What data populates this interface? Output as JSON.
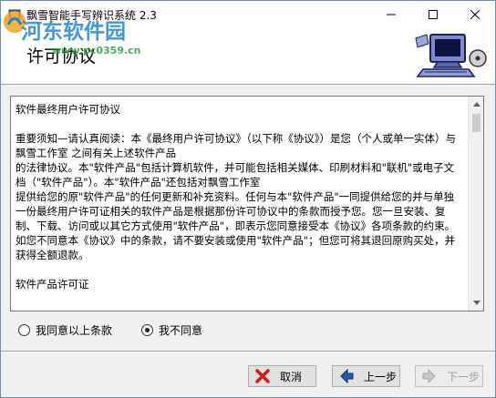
{
  "window": {
    "title": "飘雪智能手写辨识系统 2.3"
  },
  "header": {
    "title": "许可协议",
    "watermark_text": "河东软件园",
    "watermark_url": "www.pc0359.cn"
  },
  "license": {
    "text": "软件最终用户许可协议\n\n重要须知—请认真阅读：本《最终用户许可协议》（以下称《协议》）是您（个人或单一实体）与 飘雪工作室 之间有关上述软件产品\n的法律协议。本\"软件产品\"包括计算机软件，并可能包括相关媒体、印刷材料和\"联机\"或电子文档（\"软件产品\"）。本\"软件产品\"还包括对飘雪工作室\n提供给您的原\"软件产品\"的任何更新和补充资料。任何与本\"软件产品\"一同提供给您的并与单独一份最终用户许可证相关的软件产品是根据那份许可协议中的条款而授予您。您一旦安装、复制、下载、访问或以其它方式使用\"软件产品\"，即表示您同意接受本《协议》各项条款的约束。如您不同意本《协议》中的条款，请不要安装或使用\"软件产品\"；但您可将其退回原购买处，并获得全额退款。\n\n软件产品许可证"
  },
  "agreement": {
    "agree_label": "我同意以上条款",
    "disagree_label": "我不同意",
    "selected": "disagree"
  },
  "buttons": {
    "cancel_label": "取消",
    "back_label": "上一步",
    "next_label": "下一步"
  }
}
